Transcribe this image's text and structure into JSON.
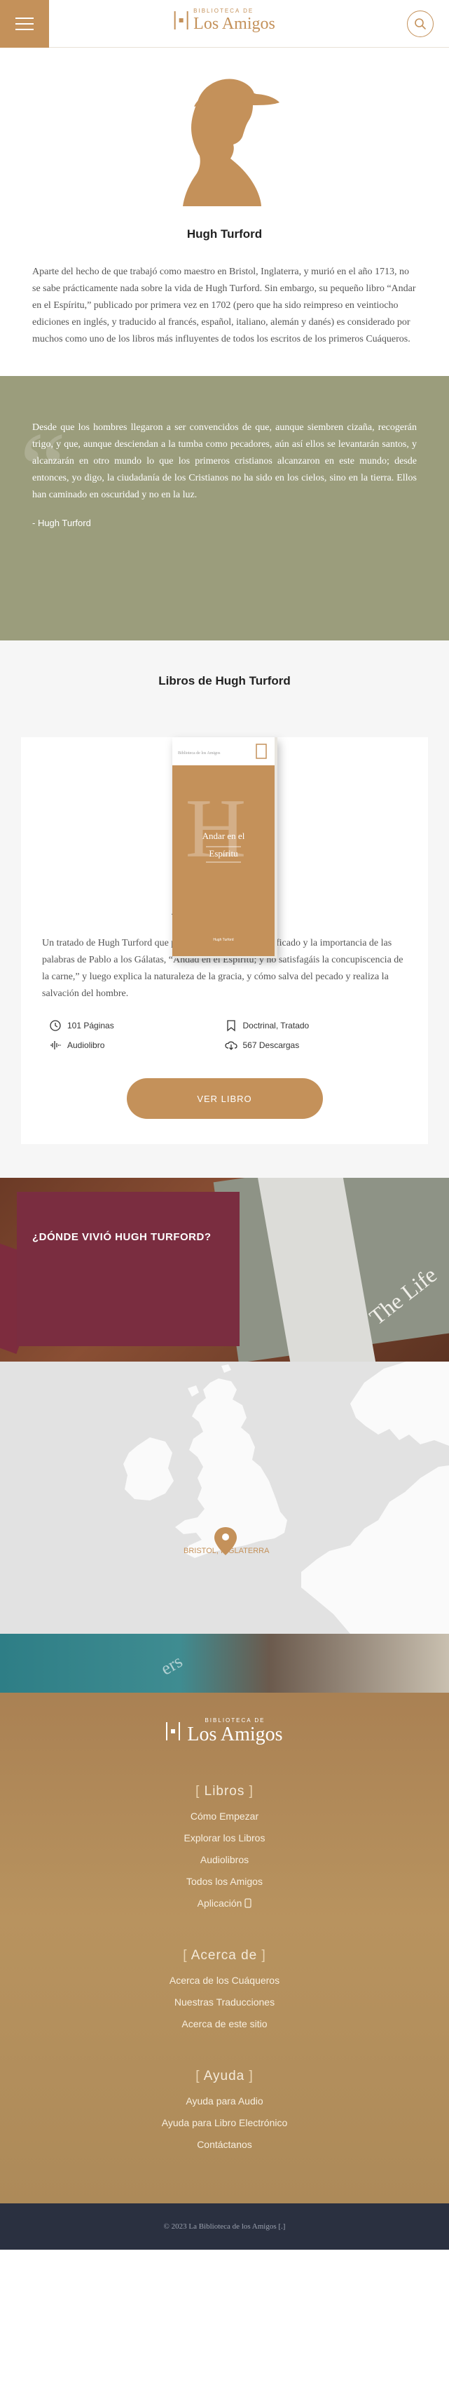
{
  "header": {
    "logo_small": "BIBLIOTECA DE",
    "logo_big": "Los Amigos",
    "menu_icon": "hamburger-icon",
    "search_icon": "search-icon"
  },
  "author": {
    "name": "Hugh Turford",
    "bio": "Aparte del hecho de que trabajó como maestro en Bristol, Inglaterra, y murió en el año 1713, no se sabe prácticamente nada sobre la vida de Hugh Turford. Sin embargo, su pequeño libro “Andar en el Espíritu,” publicado por primera vez en 1702 (pero que ha sido reimpreso en veintiocho ediciones en inglés, y traducido al francés, español, italiano, alemán y danés) es considerado por muchos como uno de los libros más influyentes de todos los escritos de los primeros Cuáqueros."
  },
  "quote": {
    "text": "Desde que los hombres llegaron a ser convencidos de que, aunque siembren cizaña, recogerán trigo, y que, aunque desciendan a la tumba como pecadores, aún así ellos se levantarán santos, y alcanzarán en otro mundo lo que los primeros cristianos alcanzaron en este mundo; desde entonces, yo digo, la ciudadanía de los Cristianos no ha sido en los cielos, sino en la tierra. Ellos han caminado en oscuridad y no en la luz.",
    "author": "- Hugh Turford"
  },
  "books": {
    "section_title": "Libros de Hugh Turford",
    "cover": {
      "series": "Biblioteca de los Amigos",
      "initial": "H",
      "title_line1": "Andar en el",
      "title_line2": "Espíritu",
      "author": "Hugh Turford"
    },
    "title": "Andar en el Espíritu",
    "description": "Un tratado de Hugh Turford que primero demuestra el significado y la importancia de las palabras de Pablo a los Gálatas, “Andad en el Espíritu; y no satisfagáis la concupiscencia de la carne,” y luego explica la naturaleza de la gracia, y cómo salva del pecado y realiza la salvación del hombre.",
    "meta": {
      "pages": "101 Páginas",
      "tags": "Doctrinal, Tratado",
      "audio": "Audiolibro",
      "downloads": "567 Descargas"
    },
    "button": "VER LIBRO"
  },
  "where": {
    "title": "¿DÓNDE VIVIÓ HUGH TURFORD?",
    "photo_text": "The Life"
  },
  "map": {
    "location": "BRISTOL, INGLATERRA",
    "pin_icon": "map-pin-icon"
  },
  "footer": {
    "logo_small": "BIBLIOTECA DE",
    "logo_big": "Los Amigos",
    "photo_text": "ers",
    "sections": [
      {
        "heading": "Libros",
        "links": [
          "Cómo Empezar",
          "Explorar los Libros",
          "Audiolibros",
          "Todos los Amigos",
          "Aplicación"
        ]
      },
      {
        "heading": "Acerca de",
        "links": [
          "Acerca de los Cuáqueros",
          "Nuestras Traducciones",
          "Acerca de este sitio"
        ]
      },
      {
        "heading": "Ayuda",
        "links": [
          "Ayuda para Audio",
          "Ayuda para Libro Electrónico",
          "Contáctanos"
        ]
      }
    ]
  },
  "copyright": "© 2023 La Biblioteca de los Amigos [.]",
  "colors": {
    "accent": "#c4915a",
    "quote_bg": "#9b9d7c",
    "where_box": "#7a2d40",
    "copyright_bg": "#2a3040"
  }
}
